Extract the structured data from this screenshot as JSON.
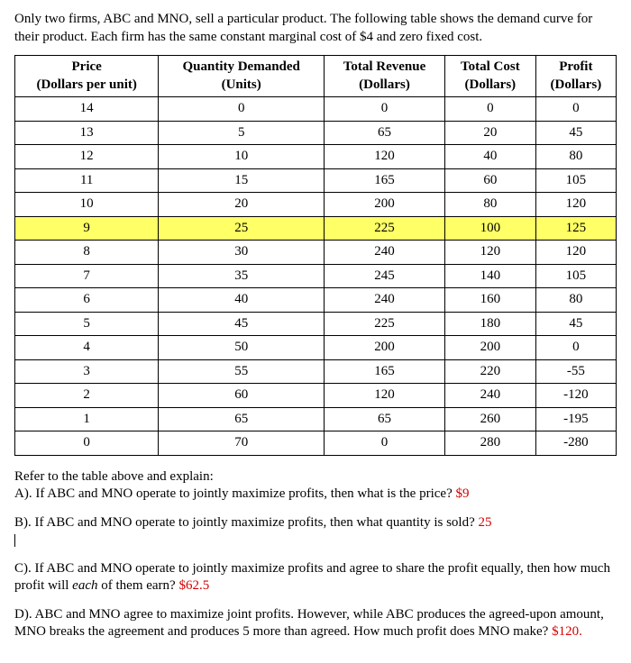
{
  "intro": "Only two firms, ABC and MNO, sell a particular product. The following table shows the demand curve for their product. Each firm has the same constant marginal cost of $4 and zero fixed cost.",
  "headers": {
    "price": {
      "line1": "Price",
      "line2": "(Dollars per unit)"
    },
    "qty": {
      "line1": "Quantity Demanded",
      "line2": "(Units)"
    },
    "rev": {
      "line1": "Total Revenue",
      "line2": "(Dollars)"
    },
    "cost": {
      "line1": "Total Cost",
      "line2": "(Dollars)"
    },
    "profit": {
      "line1": "Profit",
      "line2": "(Dollars)"
    }
  },
  "rows": [
    {
      "price": "14",
      "qty": "0",
      "rev": "0",
      "cost": "0",
      "profit": "0",
      "hl": false
    },
    {
      "price": "13",
      "qty": "5",
      "rev": "65",
      "cost": "20",
      "profit": "45",
      "hl": false
    },
    {
      "price": "12",
      "qty": "10",
      "rev": "120",
      "cost": "40",
      "profit": "80",
      "hl": false
    },
    {
      "price": "11",
      "qty": "15",
      "rev": "165",
      "cost": "60",
      "profit": "105",
      "hl": false
    },
    {
      "price": "10",
      "qty": "20",
      "rev": "200",
      "cost": "80",
      "profit": "120",
      "hl": false
    },
    {
      "price": "9",
      "qty": "25",
      "rev": "225",
      "cost": "100",
      "profit": "125",
      "hl": true
    },
    {
      "price": "8",
      "qty": "30",
      "rev": "240",
      "cost": "120",
      "profit": "120",
      "hl": false
    },
    {
      "price": "7",
      "qty": "35",
      "rev": "245",
      "cost": "140",
      "profit": "105",
      "hl": false
    },
    {
      "price": "6",
      "qty": "40",
      "rev": "240",
      "cost": "160",
      "profit": "80",
      "hl": false
    },
    {
      "price": "5",
      "qty": "45",
      "rev": "225",
      "cost": "180",
      "profit": "45",
      "hl": false
    },
    {
      "price": "4",
      "qty": "50",
      "rev": "200",
      "cost": "200",
      "profit": "0",
      "hl": false
    },
    {
      "price": "3",
      "qty": "55",
      "rev": "165",
      "cost": "220",
      "profit": "-55",
      "hl": false
    },
    {
      "price": "2",
      "qty": "60",
      "rev": "120",
      "cost": "240",
      "profit": "-120",
      "hl": false
    },
    {
      "price": "1",
      "qty": "65",
      "rev": "65",
      "cost": "260",
      "profit": "-195",
      "hl": false
    },
    {
      "price": "0",
      "qty": "70",
      "rev": "0",
      "cost": "280",
      "profit": "-280",
      "hl": false
    }
  ],
  "refer": "Refer to the table above and explain:",
  "qa": {
    "a_q": "A). If ABC and MNO operate to jointly maximize profits, then what is the price? ",
    "a_ans": "$9",
    "b_q": "B). If ABC and MNO operate to jointly maximize profits, then what quantity is sold? ",
    "b_ans": "25",
    "c_q": "C). If ABC and MNO operate to jointly maximize profits and agree to share the profit equally, then how much profit will ",
    "c_q_em": "each",
    "c_q_tail": " of them earn?  ",
    "c_ans": "$62.5",
    "d_q": "D). ABC and MNO agree to maximize joint profits. However, while ABC produces the agreed-upon amount, MNO breaks the agreement and produces 5 more than agreed. How much profit does MNO make?  ",
    "d_ans": "$120."
  }
}
